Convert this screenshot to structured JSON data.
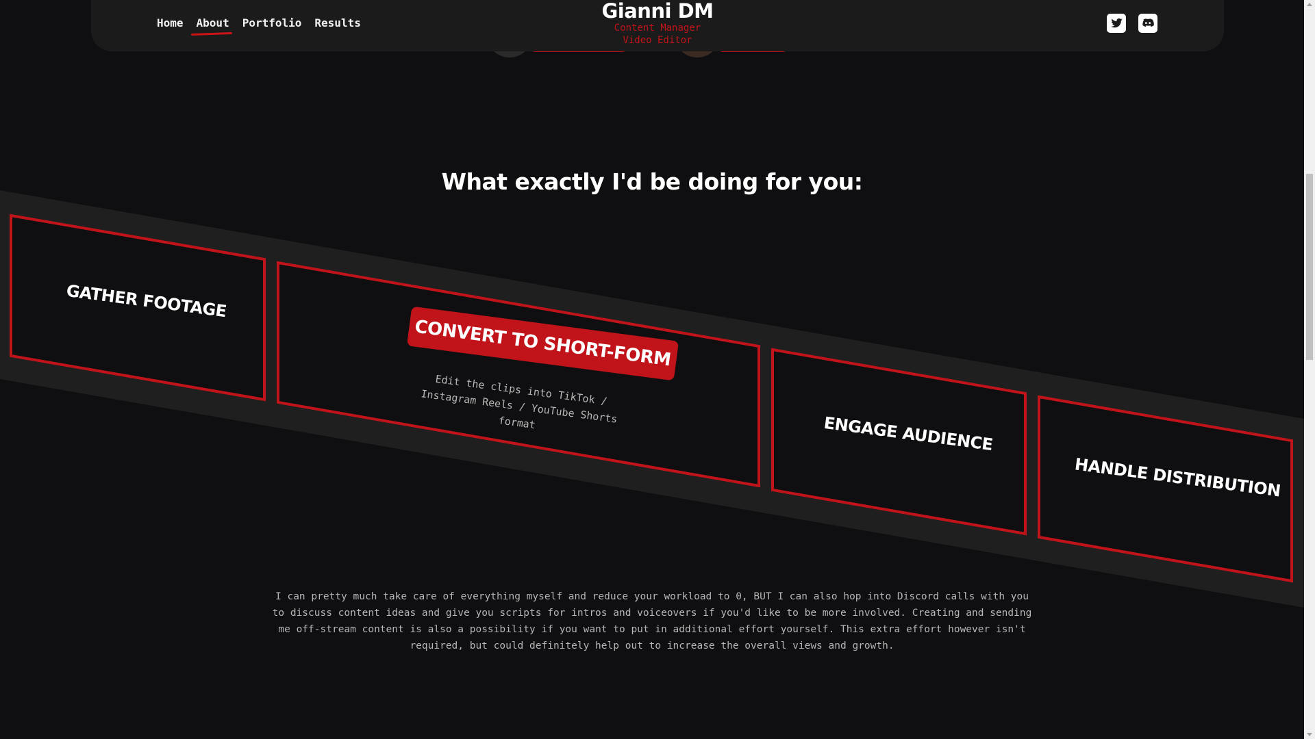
{
  "nav": {
    "links": [
      {
        "label": "Home",
        "active": false
      },
      {
        "label": "About",
        "active": true
      },
      {
        "label": "Portfolio",
        "active": false
      },
      {
        "label": "Results",
        "active": false
      }
    ],
    "brand": {
      "name": "Gianni DM",
      "subtitle_1": "Content Manager",
      "subtitle_2": "Video Editor"
    },
    "social": [
      {
        "icon": "twitter-icon"
      },
      {
        "icon": "discord-icon"
      }
    ]
  },
  "section": {
    "headline": "What exactly I'd be doing for you:",
    "cards": [
      {
        "title": "GATHER FOOTAGE",
        "highlighted": false
      },
      {
        "title": "CONVERT TO SHORT-FORM",
        "highlighted": true,
        "description": "Edit the clips into TikTok / Instagram Reels / YouTube Shorts format"
      },
      {
        "title": "ENGAGE AUDIENCE",
        "highlighted": false
      },
      {
        "title": "HANDLE DISTRIBUTION",
        "highlighted": false
      }
    ],
    "paragraph": "I can pretty much take care of everything myself and reduce your workload to 0, BUT I can also hop into Discord calls with you to discuss content ideas and give you scripts for intros and voiceovers if you'd like to be more involved. Creating and sending me off-stream content is also a possibility if you want to put in additional effort yourself. This extra effort however isn't required, but could definitely help out to increase the overall views and growth."
  },
  "colors": {
    "background": "#0f0f11",
    "band": "#1f1f1f",
    "accent": "#c1141a",
    "nav": "#1b1b1b"
  }
}
